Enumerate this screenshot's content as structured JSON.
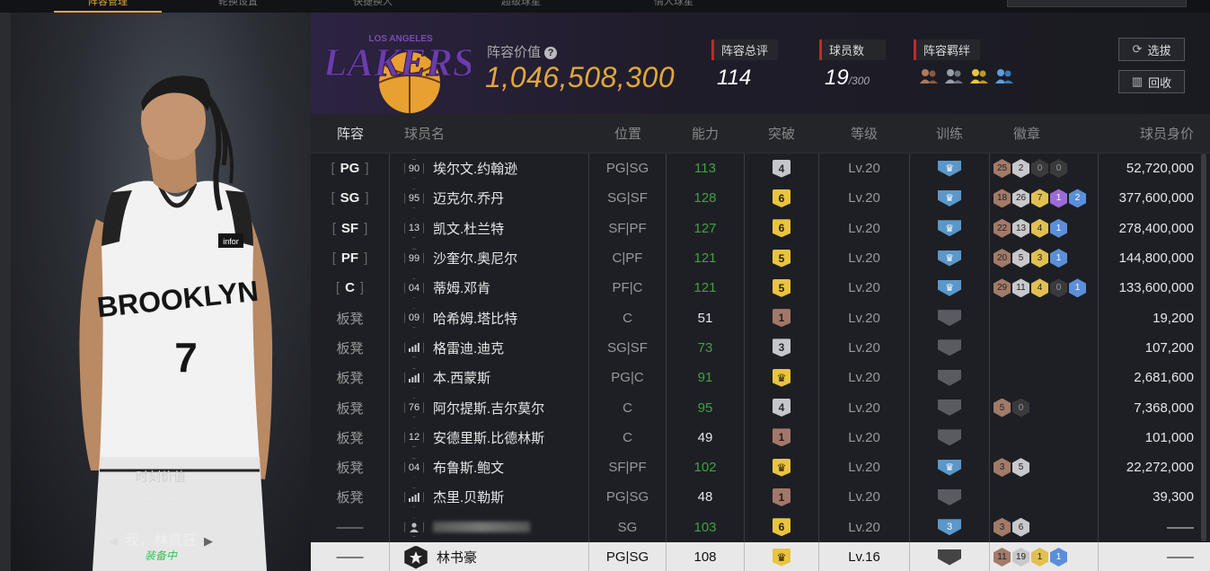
{
  "top_nav": {
    "tabs": [
      {
        "label": "阵容管理",
        "active": true
      },
      {
        "label": "轮换设置",
        "active": false
      },
      {
        "label": "快捷换人",
        "active": false
      },
      {
        "label": "超级球星",
        "active": false
      },
      {
        "label": "情人球星",
        "active": false
      }
    ]
  },
  "player_card": {
    "jersey_text": "BROOKLYN",
    "jersey_number": "7",
    "jersey_patch": "infor",
    "moment_value_label": "时刻价值",
    "moment_value": "——",
    "card_name": "我，林疯狂",
    "equipped": "装备中"
  },
  "header": {
    "team_logo_text": "LAKERS",
    "team_logo_subtext": "LOS ANGELES",
    "lineup_value_label": "阵容价值",
    "lineup_value": "1,046,508,300",
    "total_rating_label": "阵容总评",
    "total_rating": "114",
    "player_count_label": "球员数",
    "player_count": "19",
    "player_count_max": "/300",
    "bond_label": "阵容羁绊",
    "scout_button": "选拔",
    "recycle_button": "回收"
  },
  "table": {
    "headers": [
      "阵容",
      "球员名",
      "位置",
      "能力",
      "突破",
      "等级",
      "训练",
      "徽章",
      "球员身价"
    ],
    "rows": [
      {
        "lineup": "PG",
        "starter": true,
        "rating": "90",
        "name": "埃尔文.约翰逊",
        "pos": "PG|SG",
        "ability": "113",
        "ability_color": "green",
        "break": "4",
        "break_tier": "silver",
        "level": "Lv.20",
        "train": "crown",
        "train_tier": "blue",
        "badges": [
          {
            "v": "25",
            "t": "bronze"
          },
          {
            "v": "2",
            "t": "silver"
          },
          {
            "v": "0",
            "t": "dark"
          },
          {
            "v": "0",
            "t": "dark"
          }
        ],
        "price": "52,720,000"
      },
      {
        "lineup": "SG",
        "starter": true,
        "rating": "95",
        "name": "迈克尔.乔丹",
        "pos": "SG|SF",
        "ability": "128",
        "ability_color": "green",
        "break": "6",
        "break_tier": "gold",
        "level": "Lv.20",
        "train": "crown",
        "train_tier": "blue",
        "badges": [
          {
            "v": "18",
            "t": "bronze"
          },
          {
            "v": "26",
            "t": "silver"
          },
          {
            "v": "7",
            "t": "gold"
          },
          {
            "v": "1",
            "t": "purple"
          },
          {
            "v": "2",
            "t": "blue"
          }
        ],
        "price": "377,600,000"
      },
      {
        "lineup": "SF",
        "starter": true,
        "rating": "13",
        "name": "凯文.杜兰特",
        "pos": "SF|PF",
        "ability": "127",
        "ability_color": "green",
        "break": "6",
        "break_tier": "gold",
        "level": "Lv.20",
        "train": "crown",
        "train_tier": "blue",
        "badges": [
          {
            "v": "22",
            "t": "bronze"
          },
          {
            "v": "13",
            "t": "silver"
          },
          {
            "v": "4",
            "t": "gold"
          },
          {
            "v": "1",
            "t": "blue"
          }
        ],
        "price": "278,400,000"
      },
      {
        "lineup": "PF",
        "starter": true,
        "rating": "99",
        "name": "沙奎尔.奥尼尔",
        "pos": "C|PF",
        "ability": "121",
        "ability_color": "green",
        "break": "5",
        "break_tier": "gold",
        "level": "Lv.20",
        "train": "crown",
        "train_tier": "blue",
        "badges": [
          {
            "v": "20",
            "t": "bronze"
          },
          {
            "v": "5",
            "t": "silver"
          },
          {
            "v": "3",
            "t": "gold"
          },
          {
            "v": "1",
            "t": "blue"
          }
        ],
        "price": "144,800,000"
      },
      {
        "lineup": "C",
        "starter": true,
        "rating": "04",
        "name": "蒂姆.邓肯",
        "pos": "PF|C",
        "ability": "121",
        "ability_color": "green",
        "break": "5",
        "break_tier": "gold",
        "level": "Lv.20",
        "train": "crown",
        "train_tier": "blue",
        "badges": [
          {
            "v": "29",
            "t": "bronze"
          },
          {
            "v": "11",
            "t": "silver"
          },
          {
            "v": "4",
            "t": "gold"
          },
          {
            "v": "0",
            "t": "dark"
          },
          {
            "v": "1",
            "t": "blue"
          }
        ],
        "price": "133,600,000"
      },
      {
        "lineup": "板凳",
        "starter": false,
        "rating": "09",
        "name": "哈希姆.塔比特",
        "pos": "C",
        "ability": "51",
        "ability_color": "white",
        "break": "1",
        "break_tier": "bronze",
        "level": "Lv.20",
        "train": "",
        "train_tier": "gray",
        "badges": [],
        "price": "19,200"
      },
      {
        "lineup": "板凳",
        "starter": false,
        "rating": "bars",
        "name": "格雷迪.迪克",
        "pos": "SG|SF",
        "ability": "73",
        "ability_color": "green",
        "break": "3",
        "break_tier": "silver",
        "level": "Lv.20",
        "train": "",
        "train_tier": "gray",
        "badges": [],
        "price": "107,200"
      },
      {
        "lineup": "板凳",
        "starter": false,
        "rating": "bars",
        "name": "本.西蒙斯",
        "pos": "PG|C",
        "ability": "91",
        "ability_color": "green",
        "break": "crown",
        "break_tier": "gold",
        "level": "Lv.20",
        "train": "",
        "train_tier": "gray",
        "badges": [],
        "price": "2,681,600"
      },
      {
        "lineup": "板凳",
        "starter": false,
        "rating": "76",
        "name": "阿尔提斯.吉尔莫尔",
        "pos": "C",
        "ability": "95",
        "ability_color": "green",
        "break": "4",
        "break_tier": "silver",
        "level": "Lv.20",
        "train": "",
        "train_tier": "gray",
        "badges": [
          {
            "v": "5",
            "t": "bronze"
          },
          {
            "v": "0",
            "t": "dark"
          }
        ],
        "price": "7,368,000"
      },
      {
        "lineup": "板凳",
        "starter": false,
        "rating": "12",
        "name": "安德里斯.比德林斯",
        "pos": "C",
        "ability": "49",
        "ability_color": "white",
        "break": "1",
        "break_tier": "bronze",
        "level": "Lv.20",
        "train": "",
        "train_tier": "gray",
        "badges": [],
        "price": "101,000"
      },
      {
        "lineup": "板凳",
        "starter": false,
        "rating": "04",
        "name": "布鲁斯.鲍文",
        "pos": "SF|PF",
        "ability": "102",
        "ability_color": "green",
        "break": "crown",
        "break_tier": "gold",
        "level": "Lv.20",
        "train": "crown",
        "train_tier": "blue",
        "badges": [
          {
            "v": "3",
            "t": "bronze"
          },
          {
            "v": "5",
            "t": "silver"
          }
        ],
        "price": "22,272,000"
      },
      {
        "lineup": "板凳",
        "starter": false,
        "rating": "bars",
        "name": "杰里.贝勒斯",
        "pos": "PG|SG",
        "ability": "48",
        "ability_color": "white",
        "break": "1",
        "break_tier": "bronze",
        "level": "Lv.20",
        "train": "",
        "train_tier": "gray",
        "badges": [],
        "price": "39,300"
      },
      {
        "lineup": "——",
        "starter": false,
        "rating": "person",
        "name": "",
        "name_blurred": true,
        "pos": "SG",
        "ability": "103",
        "ability_color": "green",
        "break": "6",
        "break_tier": "gold",
        "level": "Lv.20",
        "train": "3",
        "train_tier": "blue",
        "badges": [
          {
            "v": "3",
            "t": "bronze"
          },
          {
            "v": "6",
            "t": "silver"
          }
        ],
        "price": "——"
      },
      {
        "lineup": "——",
        "starter": false,
        "selected": true,
        "rating": "star",
        "name": "林书豪",
        "pos": "PG|SG",
        "ability": "108",
        "ability_color": "white",
        "break": "crown",
        "break_tier": "gold",
        "level": "Lv.16",
        "train": "",
        "train_tier": "dark",
        "badges": [
          {
            "v": "11",
            "t": "bronze"
          },
          {
            "v": "19",
            "t": "silver"
          },
          {
            "v": "1",
            "t": "gold"
          },
          {
            "v": "1",
            "t": "blue"
          }
        ],
        "price": "——"
      }
    ]
  }
}
